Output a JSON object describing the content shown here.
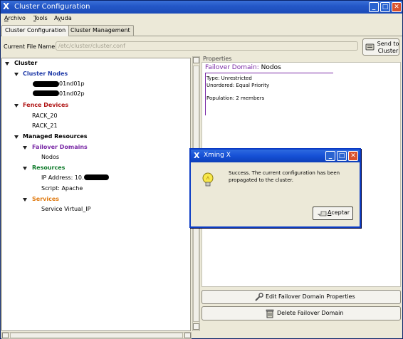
{
  "window": {
    "title": "Cluster Configuration",
    "controls": {
      "minimize": "minimize-icon",
      "maximize": "maximize-icon",
      "close": "close-icon"
    }
  },
  "menu": [
    {
      "label": "Archivo",
      "mnemonic": "A"
    },
    {
      "label": "Tools",
      "mnemonic": "T"
    },
    {
      "label": "Ayuda",
      "mnemonic": "y"
    }
  ],
  "tabs": [
    {
      "label": "Cluster Configuration",
      "active": true
    },
    {
      "label": "Cluster Management",
      "active": false
    }
  ],
  "file": {
    "label": "Current File Name:",
    "value": "/etc/cluster/cluster.conf"
  },
  "send_button": {
    "label": "Send to\nCluster"
  },
  "tree": {
    "root": "Cluster",
    "cluster_nodes": {
      "label": "Cluster Nodes",
      "items": [
        "01nd01p",
        "01nd02p"
      ]
    },
    "fence_devices": {
      "label": "Fence Devices",
      "items": [
        "RACK_20",
        "RACK_21"
      ]
    },
    "managed_resources": {
      "label": "Managed Resources",
      "failover_domains": {
        "label": "Failover Domains",
        "items": [
          "Nodos"
        ]
      },
      "resources": {
        "label": "Resources",
        "items": [
          "IP Address: 10.",
          "Script: Apache"
        ]
      },
      "services": {
        "label": "Services",
        "items": [
          "Service Virtual_IP"
        ]
      }
    }
  },
  "properties": {
    "label": "Properties",
    "heading_key": "Failover Domain:",
    "heading_value": "Nodos",
    "type": "Type: Unrestricted",
    "unordered": "Unordered: Equal Priority",
    "population": "Population: 2 members"
  },
  "actions": {
    "edit": "Edit Failover Domain Properties",
    "delete": "Delete Failover Domain"
  },
  "dialog": {
    "title": "Xming X",
    "message": "Success. The current configuration has been propagated to the cluster.",
    "ok_label": "Aceptar",
    "ok_mnemonic": "A"
  },
  "colors": {
    "title_bar": "#245ccb",
    "cluster_nodes": "#1f3aa8",
    "fence_devices": "#b01414",
    "failover_domains": "#7a2aa6",
    "resources": "#0e7a2a",
    "services": "#e07b12",
    "window_bg": "#ece9d8"
  }
}
